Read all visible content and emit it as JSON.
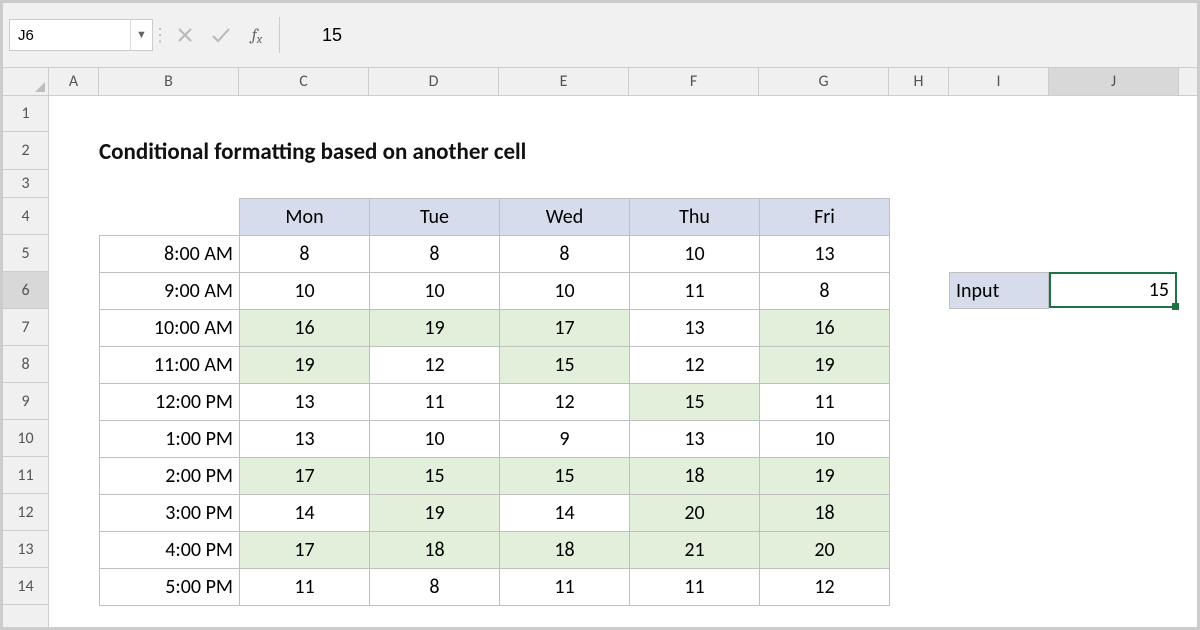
{
  "namebox": "J6",
  "formula_value": "15",
  "columns": [
    "A",
    "B",
    "C",
    "D",
    "E",
    "F",
    "G",
    "H",
    "I",
    "J"
  ],
  "col_widths": {
    "A": 50,
    "B": 140,
    "C": 130,
    "D": 130,
    "E": 130,
    "F": 130,
    "G": 130,
    "H": 60,
    "I": 100,
    "J": 130
  },
  "row_heights": {
    "1": 36,
    "2": 38,
    "3": 28,
    "4": 37,
    "5": 37,
    "6": 37,
    "7": 37,
    "8": 37,
    "9": 37,
    "10": 37,
    "11": 37,
    "12": 37,
    "13": 37,
    "14": 37
  },
  "rows": [
    "1",
    "2",
    "3",
    "4",
    "5",
    "6",
    "7",
    "8",
    "9",
    "10",
    "11",
    "12",
    "13",
    "14"
  ],
  "active_col": "J",
  "active_row": "6",
  "title": "Conditional formatting based on another cell",
  "table": {
    "headers": [
      "Mon",
      "Tue",
      "Wed",
      "Thu",
      "Fri"
    ],
    "rows": [
      {
        "time": "8:00 AM",
        "v": [
          8,
          8,
          8,
          10,
          13
        ]
      },
      {
        "time": "9:00 AM",
        "v": [
          10,
          10,
          10,
          11,
          8
        ]
      },
      {
        "time": "10:00 AM",
        "v": [
          16,
          19,
          17,
          13,
          16
        ]
      },
      {
        "time": "11:00 AM",
        "v": [
          19,
          12,
          15,
          12,
          19
        ]
      },
      {
        "time": "12:00 PM",
        "v": [
          13,
          11,
          12,
          15,
          11
        ]
      },
      {
        "time": "1:00 PM",
        "v": [
          13,
          10,
          9,
          13,
          10
        ]
      },
      {
        "time": "2:00 PM",
        "v": [
          17,
          15,
          15,
          18,
          19
        ]
      },
      {
        "time": "3:00 PM",
        "v": [
          14,
          19,
          14,
          20,
          18
        ]
      },
      {
        "time": "4:00 PM",
        "v": [
          17,
          18,
          18,
          21,
          20
        ]
      },
      {
        "time": "5:00 PM",
        "v": [
          11,
          8,
          11,
          11,
          12
        ]
      }
    ]
  },
  "input_label": "Input",
  "input_value": "15",
  "highlight_threshold": 15
}
